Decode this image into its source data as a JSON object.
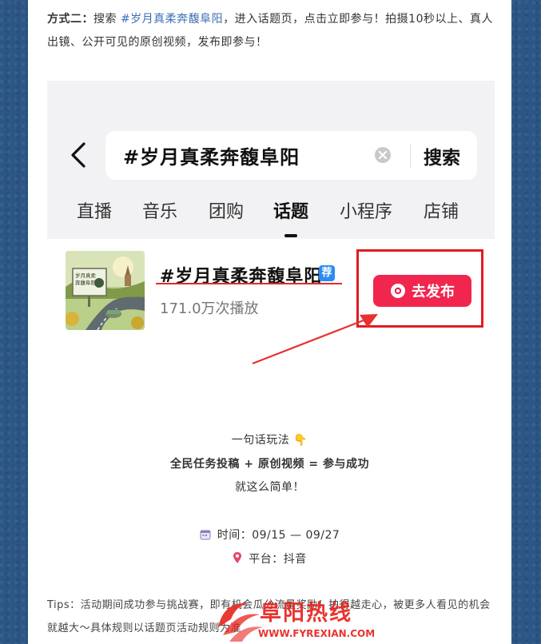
{
  "intro": {
    "label": "方式二：",
    "text_before": "搜索 ",
    "hashtag": "#岁月真柔奔馥阜阳",
    "text_after": "，进入话题页，点击立即参与！拍摄10秒以上、真人出镜、公开可见的原创视频，发布即参与！"
  },
  "search": {
    "query": "#岁月真柔奔馥阜阳",
    "button_label": "搜索"
  },
  "tabs": [
    "直播",
    "音乐",
    "团购",
    "话题",
    "小程序",
    "店铺"
  ],
  "active_tab": "话题",
  "topic": {
    "title": "#岁月真柔奔馥阜阳",
    "badge": "荐",
    "play_count": "171.0万次播放",
    "publish_label": "去发布",
    "thumbnail_text": "岁月真柔奔馥阜阳"
  },
  "play_line": "一句话玩法 👇",
  "formula": "全民任务投稿 + 原创视频 = 参与成功",
  "simple": "就这么简单！",
  "time_line": "时间：09/15 — 09/27",
  "platform_line": "平台：抖音",
  "tips": "Tips：活动期间成功参与挑战赛，即有机会瓜分流量奖励！拍得越走心，被更多人看见的机会就越大～具体规则以话题页活动规则为准",
  "watermark": {
    "name": "阜阳热线",
    "url": "WWW.FYREXIAN.COM"
  },
  "colors": {
    "background": "#2c5686",
    "accent_red": "#f0264e",
    "highlight_red": "#e01b24",
    "hashtag_blue": "#3d6fb4"
  }
}
